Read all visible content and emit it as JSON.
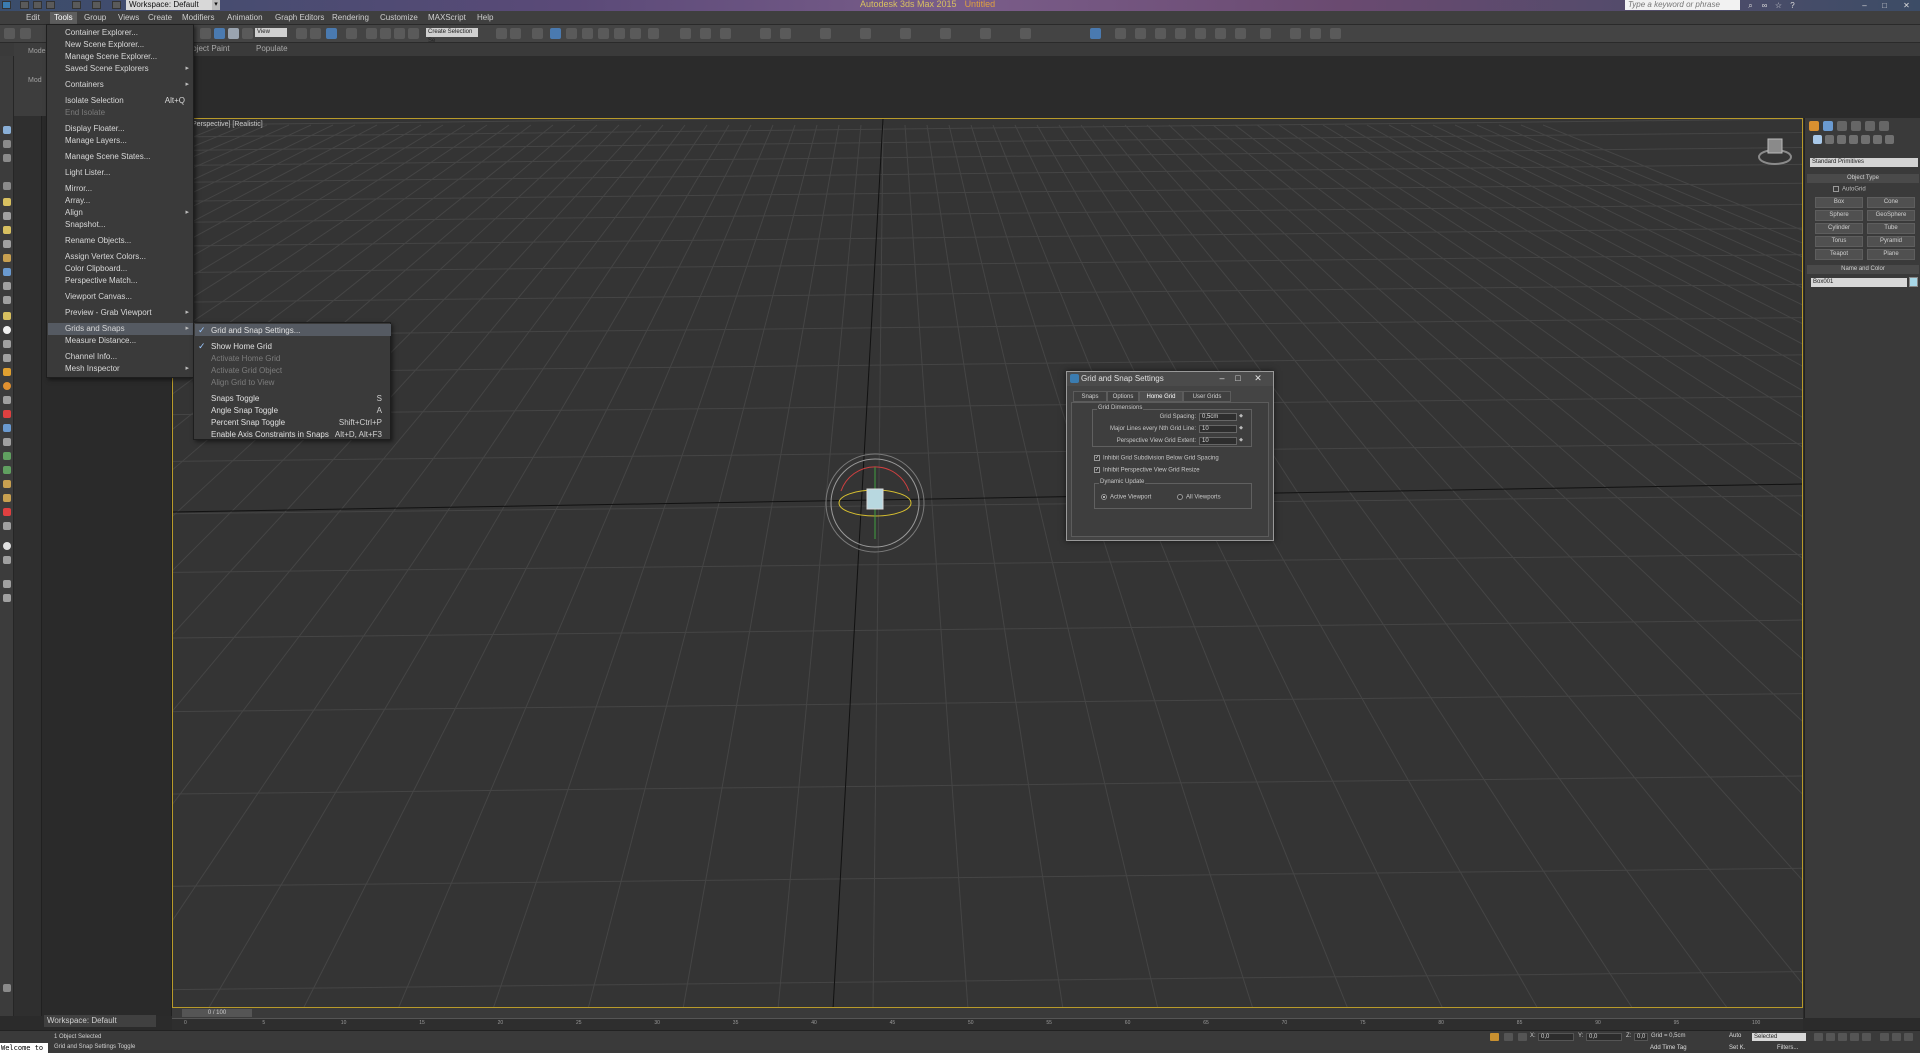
{
  "titlebar": {
    "app_title": "Autodesk 3ds Max 2015",
    "doc_title": "Untitled",
    "workspace": "Workspace: Default",
    "search_placeholder": "Type a keyword or phrase"
  },
  "menubar": {
    "items": [
      "Edit",
      "Tools",
      "Group",
      "Views",
      "Create",
      "Modifiers",
      "Animation",
      "Graph Editors",
      "Rendering",
      "Customize",
      "MAXScript",
      "Help"
    ]
  },
  "toolbar": {
    "view_combo": "View",
    "selection_set": "Create Selection Se"
  },
  "ribbon": {
    "tabs": [
      "Object Paint",
      "Populate"
    ]
  },
  "left_panel": {
    "labels": [
      "Mode",
      "Mod"
    ]
  },
  "tools_menu": {
    "items": [
      {
        "label": "Container Explorer...",
        "shortcut": "",
        "submenu": false,
        "disabled": false
      },
      {
        "label": "New Scene Explorer...",
        "shortcut": "",
        "submenu": false,
        "disabled": false
      },
      {
        "label": "Manage Scene Explorer...",
        "shortcut": "",
        "submenu": false,
        "disabled": false
      },
      {
        "label": "Saved Scene Explorers",
        "shortcut": "",
        "submenu": true,
        "disabled": false
      },
      {
        "label": "Containers",
        "shortcut": "",
        "submenu": true,
        "disabled": false
      },
      {
        "label": "Isolate Selection",
        "shortcut": "Alt+Q",
        "submenu": false,
        "disabled": false
      },
      {
        "label": "End Isolate",
        "shortcut": "",
        "submenu": false,
        "disabled": true
      },
      {
        "label": "Display Floater...",
        "shortcut": "",
        "submenu": false,
        "disabled": false
      },
      {
        "label": "Manage Layers...",
        "shortcut": "",
        "submenu": false,
        "disabled": false
      },
      {
        "label": "Manage Scene States...",
        "shortcut": "",
        "submenu": false,
        "disabled": false
      },
      {
        "label": "Light Lister...",
        "shortcut": "",
        "submenu": false,
        "disabled": false
      },
      {
        "label": "Mirror...",
        "shortcut": "",
        "submenu": false,
        "disabled": false
      },
      {
        "label": "Array...",
        "shortcut": "",
        "submenu": false,
        "disabled": false
      },
      {
        "label": "Align",
        "shortcut": "",
        "submenu": true,
        "disabled": false
      },
      {
        "label": "Snapshot...",
        "shortcut": "",
        "submenu": false,
        "disabled": false
      },
      {
        "label": "Rename Objects...",
        "shortcut": "",
        "submenu": false,
        "disabled": false
      },
      {
        "label": "Assign Vertex Colors...",
        "shortcut": "",
        "submenu": false,
        "disabled": false
      },
      {
        "label": "Color Clipboard...",
        "shortcut": "",
        "submenu": false,
        "disabled": false
      },
      {
        "label": "Perspective Match...",
        "shortcut": "",
        "submenu": false,
        "disabled": false
      },
      {
        "label": "Viewport Canvas...",
        "shortcut": "",
        "submenu": false,
        "disabled": false
      },
      {
        "label": "Preview - Grab Viewport",
        "shortcut": "",
        "submenu": true,
        "disabled": false
      },
      {
        "label": "Grids and Snaps",
        "shortcut": "",
        "submenu": true,
        "disabled": false
      },
      {
        "label": "Measure Distance...",
        "shortcut": "",
        "submenu": false,
        "disabled": false
      },
      {
        "label": "Channel Info...",
        "shortcut": "",
        "submenu": false,
        "disabled": false
      },
      {
        "label": "Mesh Inspector",
        "shortcut": "",
        "submenu": true,
        "disabled": false
      }
    ]
  },
  "grids_submenu": {
    "items": [
      {
        "label": "Grid and Snap Settings...",
        "shortcut": "",
        "checked": true,
        "disabled": false
      },
      {
        "label": "Show Home Grid",
        "shortcut": "",
        "checked": true,
        "disabled": false
      },
      {
        "label": "Activate Home Grid",
        "shortcut": "",
        "checked": false,
        "disabled": true
      },
      {
        "label": "Activate Grid Object",
        "shortcut": "",
        "checked": false,
        "disabled": true
      },
      {
        "label": "Align Grid to View",
        "shortcut": "",
        "checked": false,
        "disabled": true
      },
      {
        "label": "Snaps Toggle",
        "shortcut": "S",
        "checked": false,
        "disabled": false
      },
      {
        "label": "Angle Snap Toggle",
        "shortcut": "A",
        "checked": false,
        "disabled": false
      },
      {
        "label": "Percent Snap Toggle",
        "shortcut": "Shift+Ctrl+P",
        "checked": false,
        "disabled": false
      },
      {
        "label": "Enable Axis Constraints in Snaps",
        "shortcut": "Alt+D, Alt+F3",
        "checked": false,
        "disabled": false
      }
    ]
  },
  "viewport": {
    "label": "[Perspective] [Realistic]"
  },
  "command_panel": {
    "primitive_type": "Standard Primitives",
    "object_type_header": "Object Type",
    "autogrid": "AutoGrid",
    "primitives": [
      "Box",
      "Cone",
      "Sphere",
      "GeoSphere",
      "Cylinder",
      "Tube",
      "Torus",
      "Pyramid",
      "Teapot",
      "Plane"
    ],
    "name_color_header": "Name and Color",
    "object_name": "Box001",
    "object_color": "#a8d8e8"
  },
  "dialog": {
    "title": "Grid and Snap Settings",
    "tabs": [
      "Snaps",
      "Options",
      "Home Grid",
      "User Grids"
    ],
    "active_tab": "Home Grid",
    "grid_dimensions_label": "Grid Dimensions",
    "fields": [
      {
        "label": "Grid Spacing:",
        "value": "0,5cm"
      },
      {
        "label": "Major Lines every Nth Grid Line:",
        "value": "10"
      },
      {
        "label": "Perspective View Grid Extent:",
        "value": "10"
      }
    ],
    "checkboxes": [
      {
        "label": "Inhibit Grid Subdivision Below Grid Spacing",
        "checked": true
      },
      {
        "label": "Inhibit Perspective View Grid Resize",
        "checked": true
      }
    ],
    "dynamic_update_label": "Dynamic Update",
    "radios": [
      {
        "label": "Active Viewport",
        "selected": true
      },
      {
        "label": "All Viewports",
        "selected": false
      }
    ]
  },
  "timeline": {
    "slider": "0 / 100",
    "ticks": [
      "0",
      "5",
      "10",
      "15",
      "20",
      "25",
      "30",
      "35",
      "40",
      "45",
      "50",
      "55",
      "60",
      "65",
      "70",
      "75",
      "80",
      "85",
      "90",
      "95",
      "100"
    ]
  },
  "workspace_bar": "Workspace: Default",
  "status": {
    "object_count": "1 Object Selected",
    "prompt": "Grid and Snap Settings Toggle",
    "listener": "Welcome to",
    "grid_readout": "Grid = 0,5cm",
    "x_label": "X:",
    "x_value": "0,0",
    "y_label": "Y:",
    "y_value": "0,0",
    "z_label": "Z:",
    "z_value": "0,0",
    "auto_label": "Auto",
    "selected_combo": "Selected",
    "setkey_label": "Set K.",
    "filters_label": "Filters...",
    "add_time_tag": "Add Time Tag"
  },
  "colors": {
    "viewport_border": "#b89a2a",
    "menu_bg": "#3a3a3a",
    "accent_blue": "#4a7ab0"
  }
}
